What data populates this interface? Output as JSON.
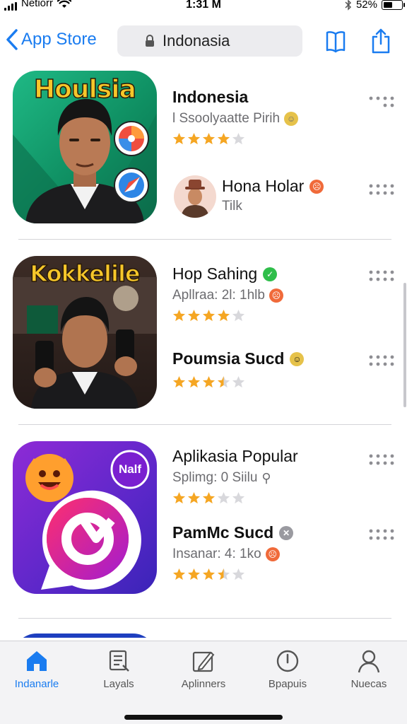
{
  "status_bar": {
    "carrier": "Netiorr",
    "time": "1:31 M",
    "battery": "52%",
    "battery_level": 0.52
  },
  "nav": {
    "back_label": "App Store",
    "search_text": "Indonasia"
  },
  "cards": [
    {
      "icon_title": "Houlsia",
      "rows": [
        {
          "title": "Indonesia",
          "subtitle": "l Ssoolyaatte Pirih",
          "rating": 4,
          "title_weight": "bold",
          "badge": "face"
        },
        {
          "title": "Hona Holar",
          "subtitle": "Tilk",
          "rating": null,
          "title_weight": "regular",
          "badge": "red-face",
          "avatar": true
        }
      ]
    },
    {
      "icon_title": "Kokkelile",
      "rows": [
        {
          "title": "Hop Sahing",
          "subtitle": "Apllraa: 2l: 1hlb",
          "rating": 4,
          "title_weight": "regular",
          "badge": "check",
          "sub_badge": "red-face"
        },
        {
          "title": "Poumsia Sucd",
          "subtitle": "",
          "rating": 3.5,
          "title_weight": "bold",
          "badge": "face"
        }
      ]
    },
    {
      "icon_title": "Nalf",
      "rows": [
        {
          "title": "Aplikasia Popular",
          "subtitle": "Splimg: 0 Siilu",
          "rating": 3,
          "title_weight": "regular",
          "badge": null,
          "sub_badge": "link"
        },
        {
          "title": "PamMc Sucd",
          "subtitle": "Insanar: 4: 1ko",
          "rating": 3.5,
          "title_weight": "bold",
          "badge": "x",
          "sub_badge": "red-face"
        }
      ]
    }
  ],
  "tabs": [
    {
      "label": "Indanarle",
      "icon": "home-icon",
      "active": true
    },
    {
      "label": "Layals",
      "icon": "list-icon",
      "active": false
    },
    {
      "label": "Aplinners",
      "icon": "edit-icon",
      "active": false
    },
    {
      "label": "Bpapuis",
      "icon": "clock-icon",
      "active": false
    },
    {
      "label": "Nuecas",
      "icon": "person-icon",
      "active": false
    }
  ],
  "colors": {
    "accent": "#1a7cf0",
    "star": "#f5a623",
    "star_empty": "#d8d8dc"
  }
}
